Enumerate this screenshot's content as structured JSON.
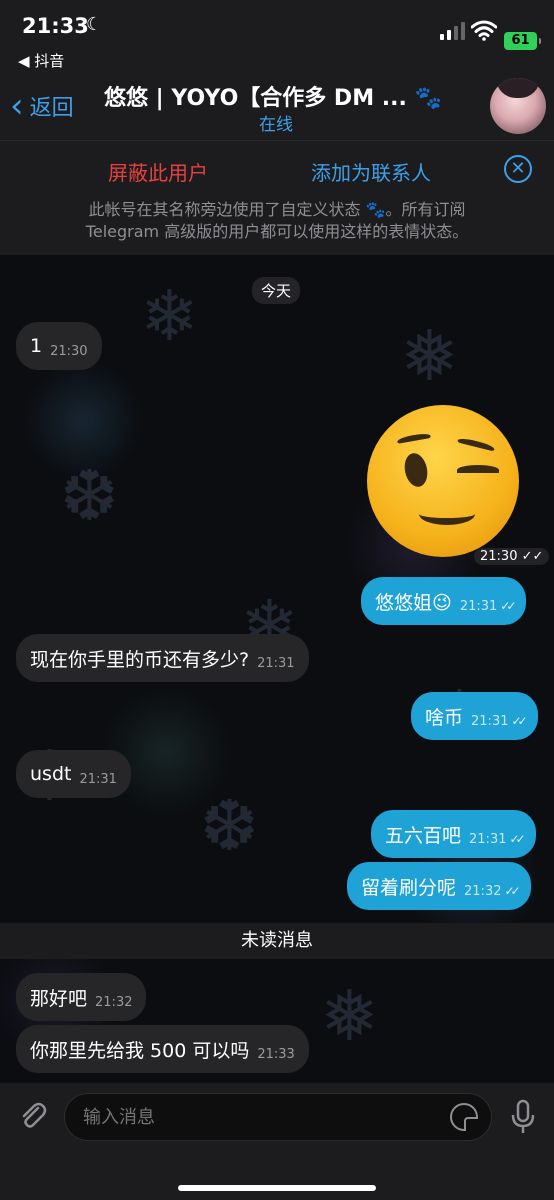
{
  "status_bar": {
    "time": "21:33",
    "back_app": "◀ 抖音",
    "battery": "61"
  },
  "header": {
    "back_label": "返回",
    "title": "悠悠 | YOYO【合作多 DM ... 🐾",
    "subtitle": "在线"
  },
  "action_bar": {
    "block_label": "屏蔽此用户",
    "add_contact_label": "添加为联系人",
    "notice_line1": "此帐号在其名称旁边使用了自定义状态 🐾。所有订阅",
    "notice_line2": "Telegram 高级版的用户都可以使用这样的表情状态。"
  },
  "chat": {
    "day_label": "今天",
    "sticker_time": "21:30",
    "unread_label": "未读消息",
    "messages": [
      {
        "direction": "in",
        "text": "1",
        "time": "21:30"
      },
      {
        "direction": "out",
        "text": "悠悠姐😉",
        "time": "21:31"
      },
      {
        "direction": "in",
        "text": "现在你手里的币还有多少?",
        "time": "21:31"
      },
      {
        "direction": "out",
        "text": "啥币",
        "time": "21:31"
      },
      {
        "direction": "in",
        "text": "usdt",
        "time": "21:31"
      },
      {
        "direction": "out",
        "text": "五六百吧",
        "time": "21:31"
      },
      {
        "direction": "out",
        "text": "留着刷分呢",
        "time": "21:32"
      },
      {
        "direction": "in",
        "text": "那好吧",
        "time": "21:32"
      },
      {
        "direction": "in",
        "text": "你那里先给我 500 可以吗",
        "time": "21:33"
      }
    ]
  },
  "input_bar": {
    "placeholder": "输入消息"
  },
  "colors": {
    "accent": "#3e9fe8",
    "outgoing_bubble": "#1fa3d6",
    "incoming_bubble": "#262628",
    "danger": "#e5423f"
  },
  "icons": [
    "moon-icon",
    "signal-icon",
    "wifi-icon",
    "battery-icon",
    "back-chevron-icon",
    "close-icon",
    "attach-icon",
    "sticker-icon",
    "microphone-icon"
  ]
}
